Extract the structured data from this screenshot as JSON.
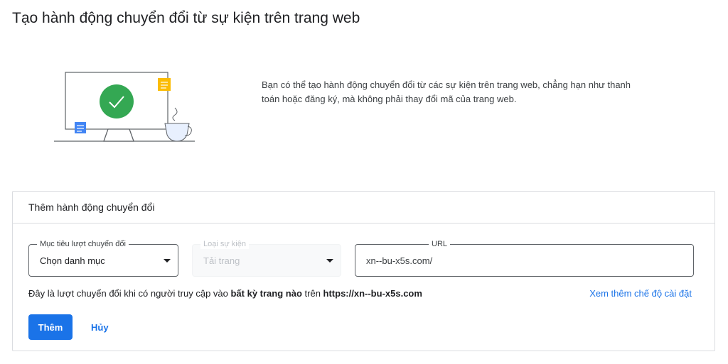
{
  "page": {
    "title": "Tạo hành động chuyển đổi từ sự kiện trên trang web"
  },
  "hero": {
    "description_line1": "Bạn có thể tạo hành động chuyển đổi từ các sự kiện trên trang web, chẳng hạn như thanh",
    "description_line2": "toán hoặc đăng ký, mà không phải thay đổi mã của trang web."
  },
  "card": {
    "title": "Thêm hành động chuyển đổi",
    "goal_field": {
      "label": "Mục tiêu lượt chuyển đổi",
      "value": "Chọn danh mục"
    },
    "event_field": {
      "label": "Loại sự kiện",
      "value": "Tải trang",
      "disabled": true
    },
    "url_field": {
      "label": "URL",
      "value": "xn--bu-x5s.com/"
    },
    "info": {
      "prefix": "Đây là lượt chuyển đổi khi có người truy cập vào ",
      "emphasis": "bất kỳ trang nào",
      "middle": " trên ",
      "url": "https://xn--bu-x5s.com"
    },
    "more_settings_link": "Xem thêm chế độ cài đặt",
    "add_button": "Thêm",
    "cancel_button": "Hủy"
  },
  "colors": {
    "accent": "#1a73e8",
    "check_circle": "#34a853",
    "sticky_note": "#fbbc04",
    "note_blue": "#4285f4",
    "cup": "#e8f0fe"
  },
  "icons": {
    "dropdown": "caret-down-icon",
    "check": "check-icon"
  }
}
